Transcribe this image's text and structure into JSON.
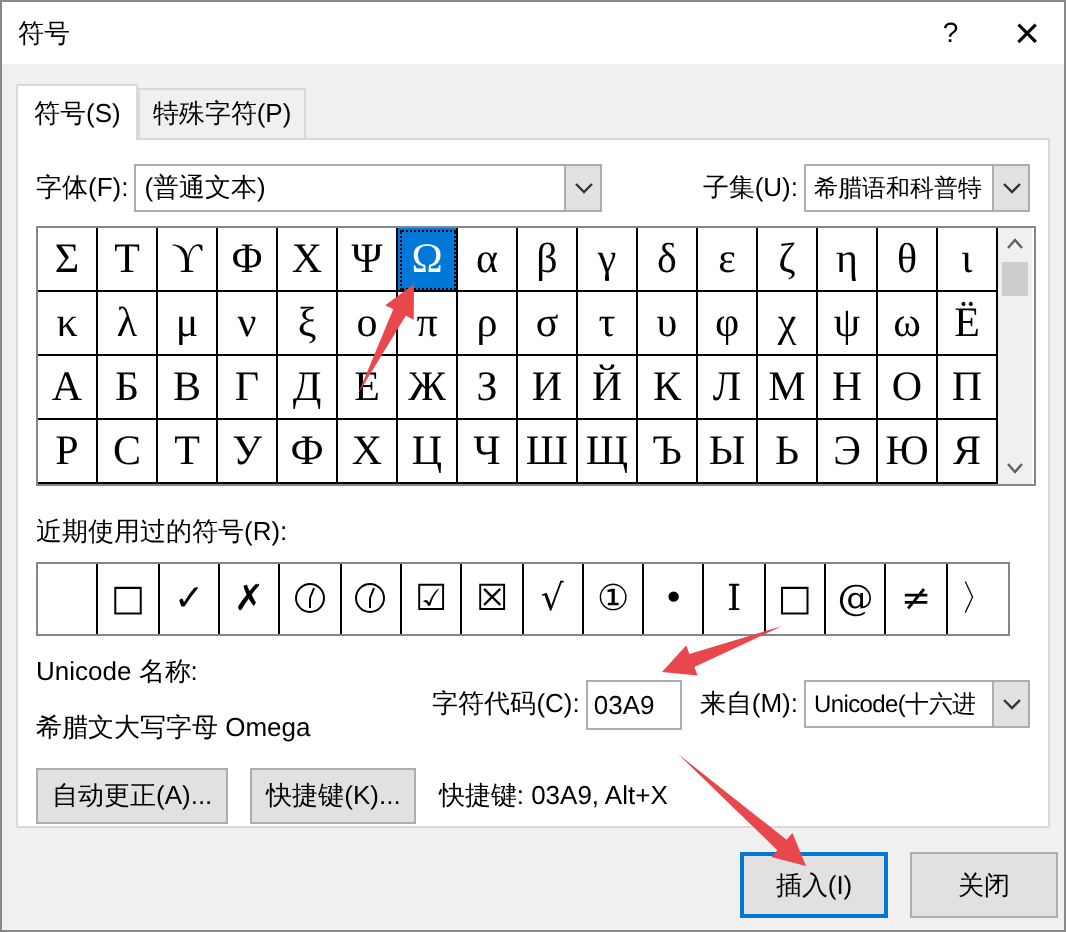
{
  "window": {
    "title": "符号",
    "help": "?",
    "close": "×"
  },
  "tabs": [
    {
      "label": "符号(S)",
      "selected": true
    },
    {
      "label": "特殊字符(P)",
      "selected": false
    }
  ],
  "font": {
    "label": "字体(F):",
    "value": "(普通文本)"
  },
  "subset": {
    "label": "子集(U):",
    "value": "希腊语和科普特"
  },
  "grid": [
    [
      {
        "char": "Σ",
        "selected": false
      },
      {
        "char": "Τ",
        "selected": false
      },
      {
        "char": "ϒ",
        "selected": false
      },
      {
        "char": "Φ",
        "selected": false
      },
      {
        "char": "Χ",
        "selected": false
      },
      {
        "char": "Ψ",
        "selected": false
      },
      {
        "char": "Ω",
        "selected": true
      },
      {
        "char": "α",
        "selected": false
      },
      {
        "char": "β",
        "selected": false
      },
      {
        "char": "γ",
        "selected": false
      },
      {
        "char": "δ",
        "selected": false
      },
      {
        "char": "ε",
        "selected": false
      },
      {
        "char": "ζ",
        "selected": false
      },
      {
        "char": "η",
        "selected": false
      },
      {
        "char": "θ",
        "selected": false
      },
      {
        "char": "ι",
        "selected": false
      }
    ],
    [
      {
        "char": "κ",
        "selected": false
      },
      {
        "char": "λ",
        "selected": false
      },
      {
        "char": "μ",
        "selected": false
      },
      {
        "char": "ν",
        "selected": false
      },
      {
        "char": "ξ",
        "selected": false
      },
      {
        "char": "ο",
        "selected": false
      },
      {
        "char": "π",
        "selected": false
      },
      {
        "char": "ρ",
        "selected": false
      },
      {
        "char": "σ",
        "selected": false
      },
      {
        "char": "τ",
        "selected": false
      },
      {
        "char": "υ",
        "selected": false
      },
      {
        "char": "φ",
        "selected": false
      },
      {
        "char": "χ",
        "selected": false
      },
      {
        "char": "ψ",
        "selected": false
      },
      {
        "char": "ω",
        "selected": false
      },
      {
        "char": "Ё",
        "selected": false
      }
    ],
    [
      {
        "char": "А",
        "selected": false
      },
      {
        "char": "Б",
        "selected": false
      },
      {
        "char": "В",
        "selected": false
      },
      {
        "char": "Г",
        "selected": false
      },
      {
        "char": "Д",
        "selected": false
      },
      {
        "char": "Е",
        "selected": false
      },
      {
        "char": "Ж",
        "selected": false
      },
      {
        "char": "З",
        "selected": false
      },
      {
        "char": "И",
        "selected": false
      },
      {
        "char": "Й",
        "selected": false
      },
      {
        "char": "К",
        "selected": false
      },
      {
        "char": "Л",
        "selected": false
      },
      {
        "char": "М",
        "selected": false
      },
      {
        "char": "Н",
        "selected": false
      },
      {
        "char": "О",
        "selected": false
      },
      {
        "char": "П",
        "selected": false
      }
    ],
    [
      {
        "char": "Р",
        "selected": false
      },
      {
        "char": "С",
        "selected": false
      },
      {
        "char": "Т",
        "selected": false
      },
      {
        "char": "У",
        "selected": false
      },
      {
        "char": "Ф",
        "selected": false
      },
      {
        "char": "Х",
        "selected": false
      },
      {
        "char": "Ц",
        "selected": false
      },
      {
        "char": "Ч",
        "selected": false
      },
      {
        "char": "Ш",
        "selected": false
      },
      {
        "char": "Щ",
        "selected": false
      },
      {
        "char": "Ъ",
        "selected": false
      },
      {
        "char": "Ы",
        "selected": false
      },
      {
        "char": "Ь",
        "selected": false
      },
      {
        "char": "Э",
        "selected": false
      },
      {
        "char": "Ю",
        "selected": false
      },
      {
        "char": "Я",
        "selected": false
      }
    ]
  ],
  "recent": {
    "label": "近期使用过的符号(R):",
    "items": [
      {
        "kind": "blank"
      },
      {
        "kind": "char",
        "char": "□"
      },
      {
        "kind": "char",
        "char": "✓"
      },
      {
        "kind": "char",
        "char": "✗"
      },
      {
        "kind": "clock"
      },
      {
        "kind": "clock"
      },
      {
        "kind": "char",
        "char": "☑"
      },
      {
        "kind": "char",
        "char": "☒"
      },
      {
        "kind": "char",
        "char": "√"
      },
      {
        "kind": "char",
        "char": "①"
      },
      {
        "kind": "char",
        "char": "•"
      },
      {
        "kind": "char",
        "char": "I"
      },
      {
        "kind": "char",
        "char": "□"
      },
      {
        "kind": "char",
        "char": "@"
      },
      {
        "kind": "char",
        "char": "≠"
      },
      {
        "kind": "char",
        "char": "〉"
      }
    ]
  },
  "unicode_name": {
    "label": "Unicode 名称:",
    "value": "希腊文大写字母 Omega"
  },
  "char_code": {
    "label": "字符代码(C):",
    "value": "03A9"
  },
  "from": {
    "label": "来自(M):",
    "value": "Unicode(十六进"
  },
  "buttons": [
    "自动更正(A)...",
    "快捷键(K)..."
  ],
  "shortcut": "快捷键: 03A9, Alt+X",
  "footer_buttons": [
    {
      "label": "插入(I)",
      "default": true
    },
    {
      "label": "关闭",
      "default": false
    }
  ]
}
